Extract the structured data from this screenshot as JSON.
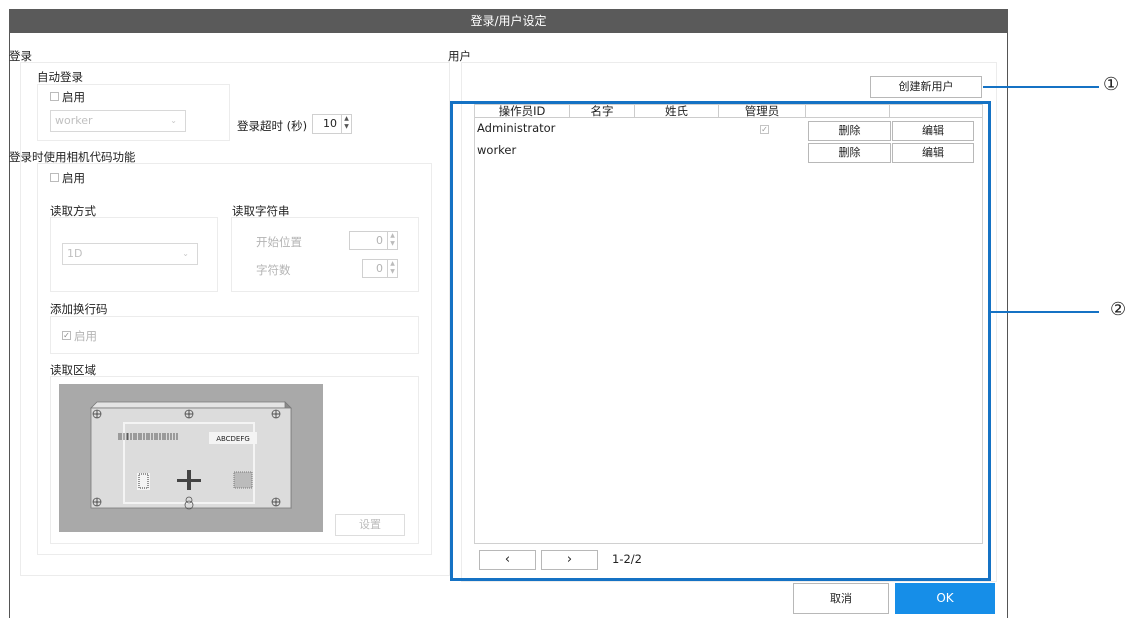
{
  "window": {
    "title": "登录/用户设定"
  },
  "login": {
    "section_title": "登录",
    "auto_login": {
      "title": "自动登录",
      "enable_label": "启用",
      "user_select_value": "worker",
      "timeout_label": "登录超时 (秒)",
      "timeout_value": "10"
    },
    "camera_code": {
      "title": "登录时使用相机代码功能",
      "enable_label": "启用",
      "read_method_title": "读取方式",
      "read_method_value": "1D",
      "read_string_title": "读取字符串",
      "start_pos_label": "开始位置",
      "start_pos_value": "0",
      "char_count_label": "字符数",
      "char_count_value": "0",
      "add_newline_title": "添加换行码",
      "add_newline_enable": "启用",
      "read_area_title": "读取区域",
      "preview_barcode_text": "ABCDEFG",
      "settings_button": "设置"
    }
  },
  "users": {
    "section_title": "用户",
    "create_button": "创建新用户",
    "columns": [
      "操作员ID",
      "名字",
      "姓氏",
      "管理员"
    ],
    "rows": [
      {
        "id": "Administrator",
        "first": "",
        "last": "",
        "admin": true,
        "delete": "删除",
        "edit": "编辑"
      },
      {
        "id": "worker",
        "first": "",
        "last": "",
        "admin": false,
        "delete": "删除",
        "edit": "编辑"
      }
    ],
    "pager": {
      "prev": "‹",
      "next": "›",
      "info": "1-2/2"
    }
  },
  "footer": {
    "cancel": "取消",
    "ok": "OK"
  },
  "callouts": [
    "①",
    "②"
  ],
  "colors": {
    "titlebar": "#5a5a5a",
    "callout_blue": "#1572c4",
    "ok_button": "#168ee8"
  }
}
